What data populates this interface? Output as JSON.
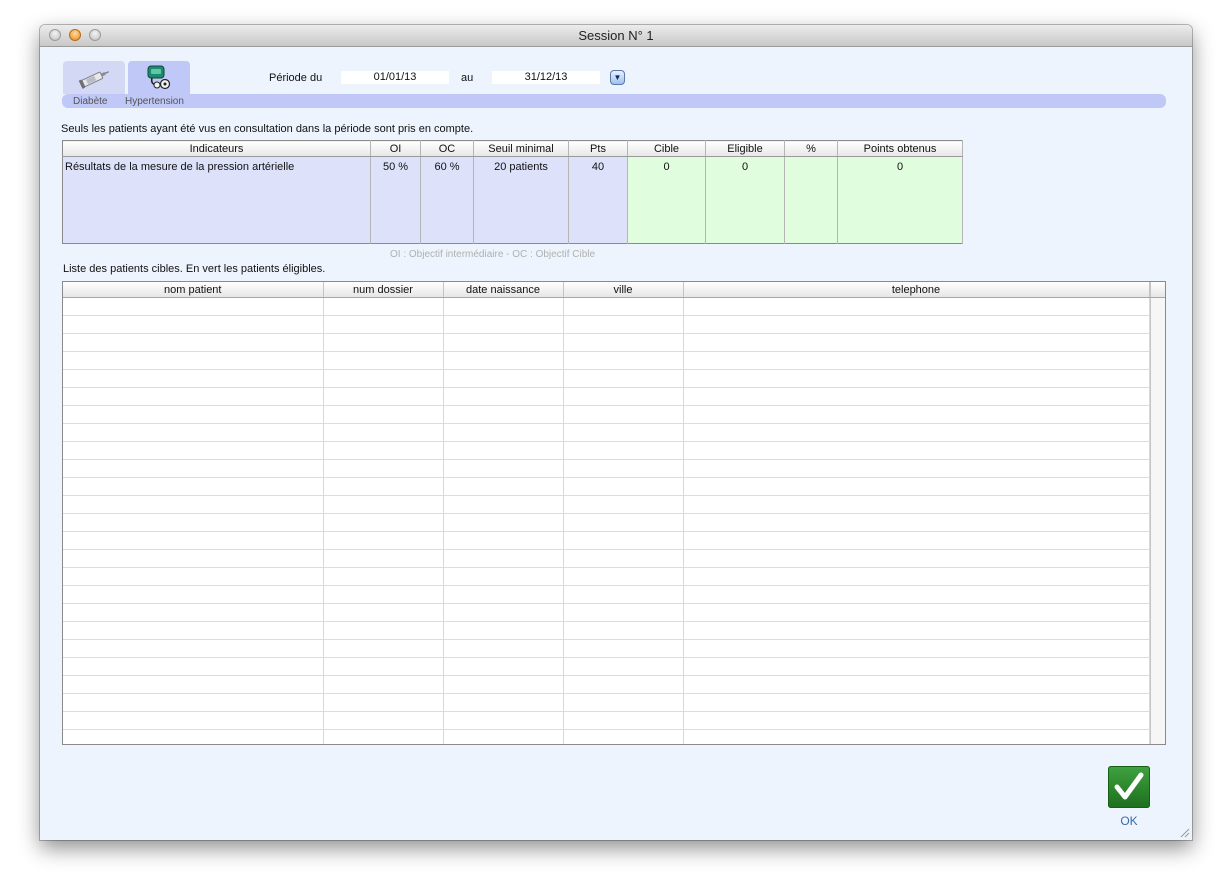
{
  "window": {
    "title": "Session N° 1"
  },
  "tabs": [
    {
      "label": "Diabète",
      "icon": "syringe-icon",
      "selected": false
    },
    {
      "label": "Hypertension",
      "icon": "blood-pressure-cuff-icon",
      "selected": true
    }
  ],
  "period": {
    "label_from": "Période du",
    "from": "01/01/13",
    "label_to": "au",
    "to": "31/12/13",
    "popup_icon": "dropdown-arrow-icon"
  },
  "note": "Seuls les patients ayant été vus en consultation dans la période sont pris en compte.",
  "indicators": {
    "headers": [
      "Indicateurs",
      "OI",
      "OC",
      "Seuil minimal",
      "Pts",
      "Cible",
      "Eligible",
      "%",
      "Points obtenus"
    ],
    "rows": [
      {
        "indicateur": "Résultats de la mesure de la pression artérielle",
        "oi": "50 %",
        "oc": "60 %",
        "seuil": "20 patients",
        "pts": "40",
        "cible": "0",
        "eligible": "0",
        "pct": "",
        "points": "0"
      }
    ]
  },
  "legend": "OI : Objectif intermédiaire - OC : Objectif Cible",
  "patients": {
    "caption": "Liste des patients cibles. En vert les patients éligibles.",
    "headers": [
      "nom patient",
      "num dossier",
      "date naissance",
      "ville",
      "telephone"
    ],
    "rows": []
  },
  "ok": {
    "label": "OK",
    "icon": "checkmark-icon"
  },
  "colors": {
    "window_bg": "#eef4fd",
    "tabbar": "#bfc8f6",
    "cell_blue": "#dde2fa",
    "cell_green": "#e0fddd",
    "ok_green": "#2e8b2e"
  }
}
